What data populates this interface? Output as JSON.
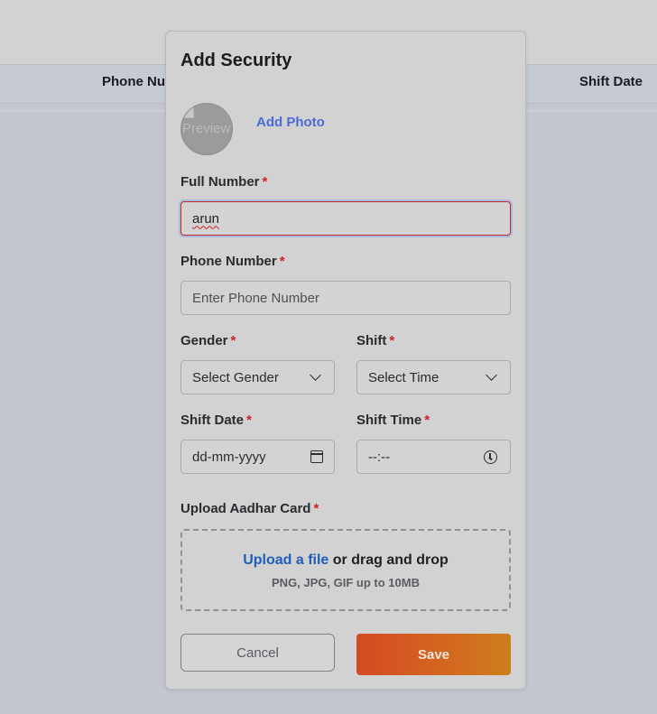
{
  "background_table": {
    "columns": [
      "Phone Nu",
      "Shift Date"
    ]
  },
  "modal": {
    "title": "Add Security",
    "avatar_alt": "Preview",
    "add_photo_label": "Add Photo",
    "required_mark": "*",
    "full_number": {
      "label": "Full Number",
      "value": "arun"
    },
    "phone_number": {
      "label": "Phone Number",
      "placeholder": "Enter Phone Number"
    },
    "gender": {
      "label": "Gender",
      "selected": "Select Gender"
    },
    "shift": {
      "label": "Shift",
      "selected": "Select Time"
    },
    "shift_date": {
      "label": "Shift Date",
      "placeholder": "dd-mm-yyyy"
    },
    "shift_time": {
      "label": "Shift Time",
      "placeholder": "--:--"
    },
    "upload": {
      "label": "Upload Aadhar Card",
      "link_text": "Upload a file",
      "rest_text": "or drag and drop",
      "hint": "PNG, JPG, GIF up to 10MB"
    },
    "buttons": {
      "cancel": "Cancel",
      "save": "Save"
    }
  },
  "colors": {
    "accent_link": "#4a6ad6",
    "upload_link": "#1f5fb8",
    "required": "#d21f1f",
    "save_start": "#d44a23",
    "save_end": "#cc7f1c"
  },
  "icons": [
    "chevron-down-icon",
    "calendar-icon",
    "clock-icon",
    "broken-image-icon"
  ]
}
